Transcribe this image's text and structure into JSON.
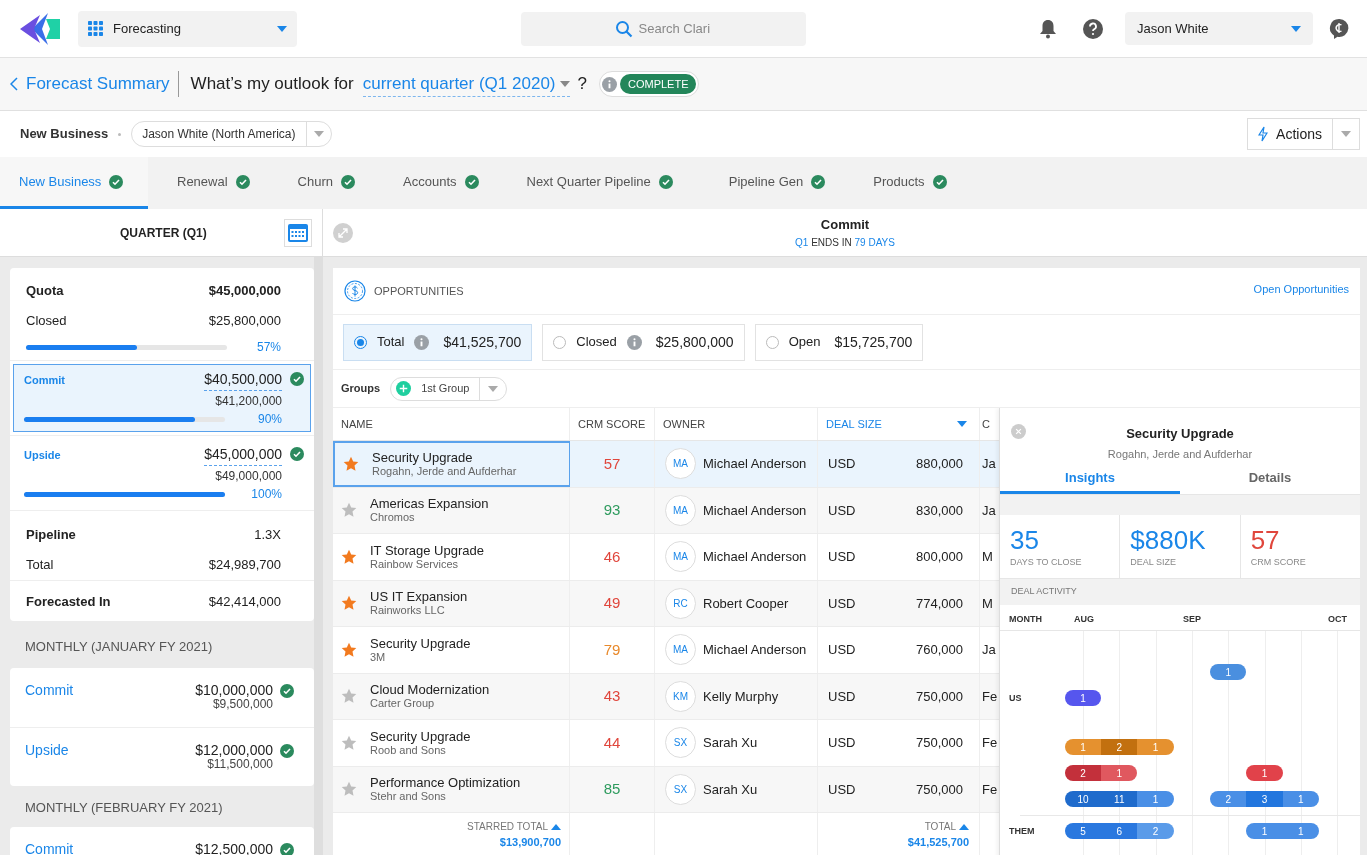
{
  "app_switcher": {
    "label": "Forecasting"
  },
  "search": {
    "placeholder": "Search Clari"
  },
  "user": {
    "name": "Jason White"
  },
  "title_bar": {
    "back": "Forecast Summary",
    "question": "What’s my outlook for",
    "period": "current quarter (Q1 2020)",
    "question_mark": "?",
    "status": "COMPLETE"
  },
  "filter_bar": {
    "segment": "New Business",
    "owner": "Jason White (North America)",
    "actions": "Actions"
  },
  "tabs": [
    {
      "label": "New Business",
      "selected": true
    },
    {
      "label": "Renewal",
      "selected": false
    },
    {
      "label": "Churn",
      "selected": false
    },
    {
      "label": "Accounts",
      "selected": false
    },
    {
      "label": "Next Quarter Pipeline",
      "selected": false
    },
    {
      "label": "Pipeline Gen",
      "selected": false
    },
    {
      "label": "Products",
      "selected": false
    }
  ],
  "left_header": {
    "title": "QUARTER (Q1)"
  },
  "right_header": {
    "title": "Commit",
    "countdown": [
      {
        "text": "Q1",
        "highlight": true
      },
      {
        "text": "ENDS IN",
        "highlight": false
      },
      {
        "text": "79 DAYS",
        "highlight": true
      }
    ]
  },
  "summary": [
    {
      "kind": "quota",
      "label": "Quota",
      "value": "$45,000,000",
      "sub_label": "Closed",
      "sub_value": "$25,800,000",
      "level": 0.55,
      "percent": "57%"
    },
    {
      "kind": "forecast",
      "label": "Commit",
      "value": "$40,500,000",
      "sub_value": "$41,200,000",
      "level": 0.85,
      "percent": "90%",
      "selected": true
    },
    {
      "kind": "forecast",
      "label": "Upside",
      "value": "$45,000,000",
      "sub_value": "$49,000,000",
      "level": 1,
      "percent": "100%",
      "selected": false
    },
    {
      "kind": "pipeline",
      "label": "Pipeline",
      "value": "1.3X",
      "sub_label": "Total",
      "sub_value": "$24,989,700"
    },
    {
      "kind": "plain",
      "label": "Forecasted In",
      "value": "$42,414,000"
    }
  ],
  "monthly": [
    {
      "title": "MONTHLY (JANUARY FY 2021)",
      "items": [
        {
          "label": "Commit",
          "value": "$10,000,000",
          "sub_value": "$9,500,000"
        },
        {
          "label": "Upside",
          "value": "$12,000,000",
          "sub_value": "$11,500,000"
        }
      ]
    },
    {
      "title": "MONTHLY (FEBRUARY FY 2021)",
      "items": [
        {
          "label": "Commit",
          "value": "$12,500,000"
        }
      ]
    }
  ],
  "opportunities": {
    "title": "OPPORTUNITIES",
    "link": "Open Opportunities",
    "filters": [
      {
        "label": "Total",
        "info": true,
        "value": "$41,525,700",
        "selected": true
      },
      {
        "label": "Closed",
        "info": true,
        "value": "$25,800,000",
        "selected": false
      },
      {
        "label": "Open",
        "info": false,
        "value": "$15,725,700",
        "selected": false
      }
    ],
    "groups_label": "Groups",
    "group": "1st Group"
  },
  "table": {
    "columns": [
      {
        "label": "NAME",
        "sorted": false
      },
      {
        "label": "CRM SCORE",
        "sorted": false
      },
      {
        "label": "OWNER",
        "sorted": false
      },
      {
        "label": "DEAL SIZE",
        "sorted": true
      },
      {
        "label": "C",
        "sorted": false
      }
    ],
    "rows": [
      {
        "starred": true,
        "selected": true,
        "name": "Security Upgrade",
        "account": "Rogahn, Jerde and Aufderhar",
        "score": "57",
        "color": "#e0463c",
        "initials": "MA",
        "owner": "Michael Anderson",
        "currency": "USD",
        "amount": "880,000",
        "column_5": "Ja"
      },
      {
        "starred": false,
        "selected": false,
        "name": "Americas Expansion",
        "account": "Chromos",
        "score": "93",
        "color": "#2e9b5e",
        "initials": "MA",
        "owner": "Michael Anderson",
        "currency": "USD",
        "amount": "830,000",
        "column_5": "Ja"
      },
      {
        "starred": true,
        "selected": false,
        "name": "IT Storage Upgrade",
        "account": "Rainbow Services",
        "score": "46",
        "color": "#e0463c",
        "initials": "MA",
        "owner": "Michael Anderson",
        "currency": "USD",
        "amount": "800,000",
        "column_5": "M"
      },
      {
        "starred": true,
        "selected": false,
        "name": "US IT Expansion",
        "account": "Rainworks LLC",
        "score": "49",
        "color": "#e0463c",
        "initials": "RC",
        "owner": "Robert Cooper",
        "currency": "USD",
        "amount": "774,000",
        "column_5": "M"
      },
      {
        "starred": true,
        "selected": false,
        "name": "Security Upgrade",
        "account": "3M",
        "score": "79",
        "color": "#e8892b",
        "initials": "MA",
        "owner": "Michael Anderson",
        "currency": "USD",
        "amount": "760,000",
        "column_5": "Ja"
      },
      {
        "starred": false,
        "selected": false,
        "name": "Cloud Modernization",
        "account": "Carter Group",
        "score": "43",
        "color": "#e0463c",
        "initials": "KM",
        "owner": "Kelly Murphy",
        "currency": "USD",
        "amount": "750,000",
        "column_5": "Fe"
      },
      {
        "starred": false,
        "selected": false,
        "name": "Security Upgrade",
        "account": "Roob and Sons",
        "score": "44",
        "color": "#e0463c",
        "initials": "SX",
        "owner": "Sarah Xu",
        "currency": "USD",
        "amount": "750,000",
        "column_5": "Fe"
      },
      {
        "starred": false,
        "selected": false,
        "name": "Performance Optimization",
        "account": "Stehr and Sons",
        "score": "85",
        "color": "#2e9b5e",
        "initials": "SX",
        "owner": "Sarah Xu",
        "currency": "USD",
        "amount": "750,000",
        "column_5": "Fe"
      }
    ],
    "footer": {
      "starred_label": "STARRED TOTAL",
      "starred_value": "$13,900,700",
      "total_label": "TOTAL",
      "total_value": "$41,525,700"
    }
  },
  "detail": {
    "title": "Security Upgrade",
    "subtitle": "Rogahn, Jerde and Aufderhar",
    "tabs": [
      {
        "label": "Insights",
        "selected": true
      },
      {
        "label": "Details",
        "selected": false
      }
    ],
    "stats": [
      {
        "value": "35",
        "label": "DAYS TO CLOSE",
        "color": "#1a86e8"
      },
      {
        "value": "$880K",
        "label": "DEAL SIZE",
        "color": "#1a86e8"
      },
      {
        "value": "57",
        "label": "CRM SCORE",
        "color": "#e0463c"
      }
    ],
    "activity_title": "DEAL ACTIVITY",
    "months": [
      {
        "label": "MONTH"
      },
      {
        "label": "AUG"
      },
      {
        "label": "SEP"
      },
      {
        "label": "OCT"
      }
    ],
    "lanes": [
      {
        "bars": [
          {
            "segments": [
              {
                "text": "1",
                "color": "#4a8fdf"
              }
            ]
          }
        ]
      },
      {
        "label": "US",
        "bars": [
          {
            "segments": [
              {
                "text": "1",
                "color": "#5656ee"
              }
            ]
          }
        ]
      },
      {
        "bars": [
          {
            "segments": [
              {
                "text": "1",
                "color": "#e5912f"
              },
              {
                "text": "2",
                "color": "#c2700f"
              },
              {
                "text": "1",
                "color": "#e5912f"
              }
            ]
          }
        ]
      },
      {
        "bars": [
          {
            "segments": [
              {
                "text": "2",
                "color": "#c3303b"
              },
              {
                "text": "1",
                "color": "#e0585f"
              }
            ]
          },
          {
            "segments": [
              {
                "text": "1",
                "color": "#e1424a"
              }
            ]
          }
        ]
      },
      {
        "bars": [
          {
            "segments": [
              {
                "text": "10",
                "color": "#1f6bcc"
              },
              {
                "text": "11",
                "color": "#1f6bcc"
              },
              {
                "text": "1",
                "color": "#4a8fe6"
              }
            ]
          },
          {
            "segments": [
              {
                "text": "2",
                "color": "#4a8fe6"
              },
              {
                "text": "3",
                "color": "#2276de"
              },
              {
                "text": "1",
                "color": "#4a8fe6"
              }
            ]
          }
        ]
      },
      {
        "label": "THEM",
        "bars": [
          {
            "segments": [
              {
                "text": "5",
                "color": "#2a78df"
              },
              {
                "text": "6",
                "color": "#2a78df"
              },
              {
                "text": "2",
                "color": "#5a9be9"
              }
            ]
          },
          {
            "segments": [
              {
                "text": "1",
                "color": "#4a8fe6"
              },
              {
                "text": "1",
                "color": "#4a8fe6"
              }
            ]
          }
        ]
      }
    ]
  }
}
